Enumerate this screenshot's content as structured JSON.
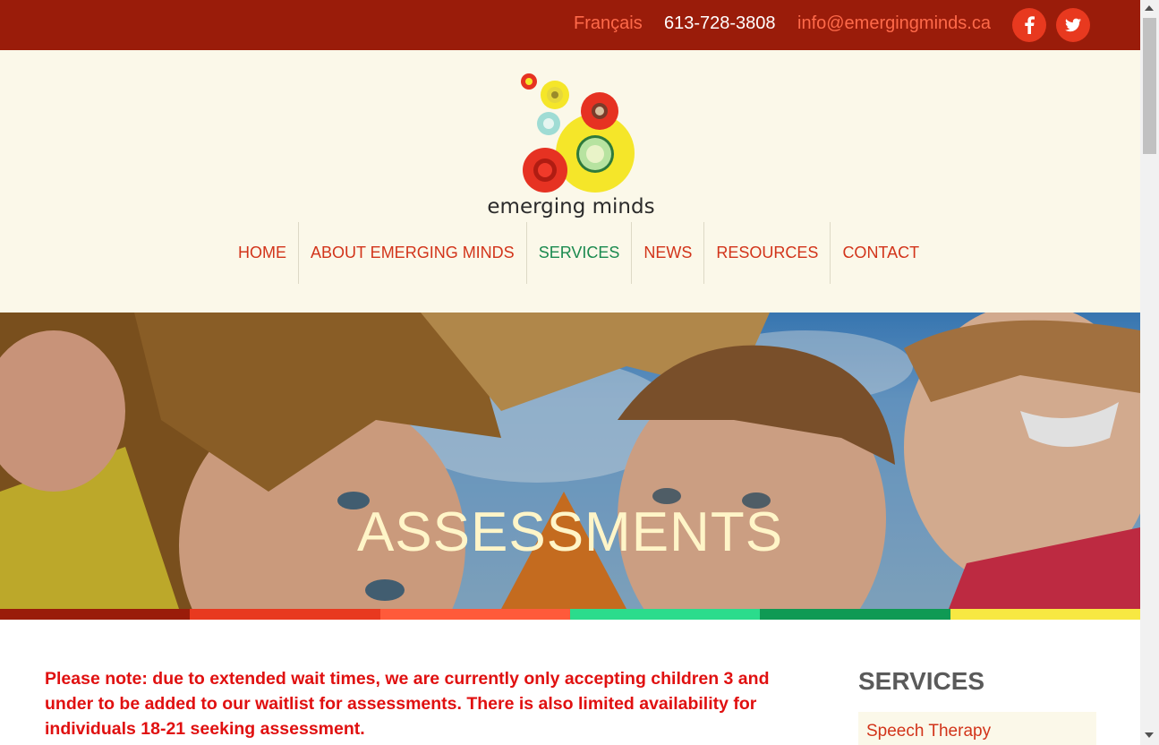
{
  "topbar": {
    "language": "Français",
    "phone": "613-728-3808",
    "email": "info@emergingminds.ca",
    "social": [
      "facebook-icon",
      "twitter-icon"
    ]
  },
  "logo": {
    "text": "emerging minds"
  },
  "nav": {
    "items": [
      {
        "label": "HOME"
      },
      {
        "label": "ABOUT EMERGING MINDS"
      },
      {
        "label": "SERVICES"
      },
      {
        "label": "NEWS"
      },
      {
        "label": "RESOURCES"
      },
      {
        "label": "CONTACT"
      }
    ],
    "active": "SERVICES"
  },
  "hero": {
    "title": "ASSESSMENTS"
  },
  "stripe_colors": [
    "#9a1c0a",
    "#e8391f",
    "#ff5a3a",
    "#2bdc8c",
    "#0f9a54",
    "#f7e842"
  ],
  "notice": "Please note: due to extended wait times, we are currently only accepting children 3 and under to be added to our waitlist for assessments.  There is also limited availability for individuals 18-21 seeking assessment.",
  "sidebar": {
    "title": "SERVICES",
    "items": [
      {
        "label": "Speech Therapy"
      }
    ]
  },
  "colors": {
    "accent": "#d2341a",
    "topbar": "#9a1c0a",
    "active_nav": "#1b8a4f",
    "header_bg": "#fbf8e9"
  }
}
